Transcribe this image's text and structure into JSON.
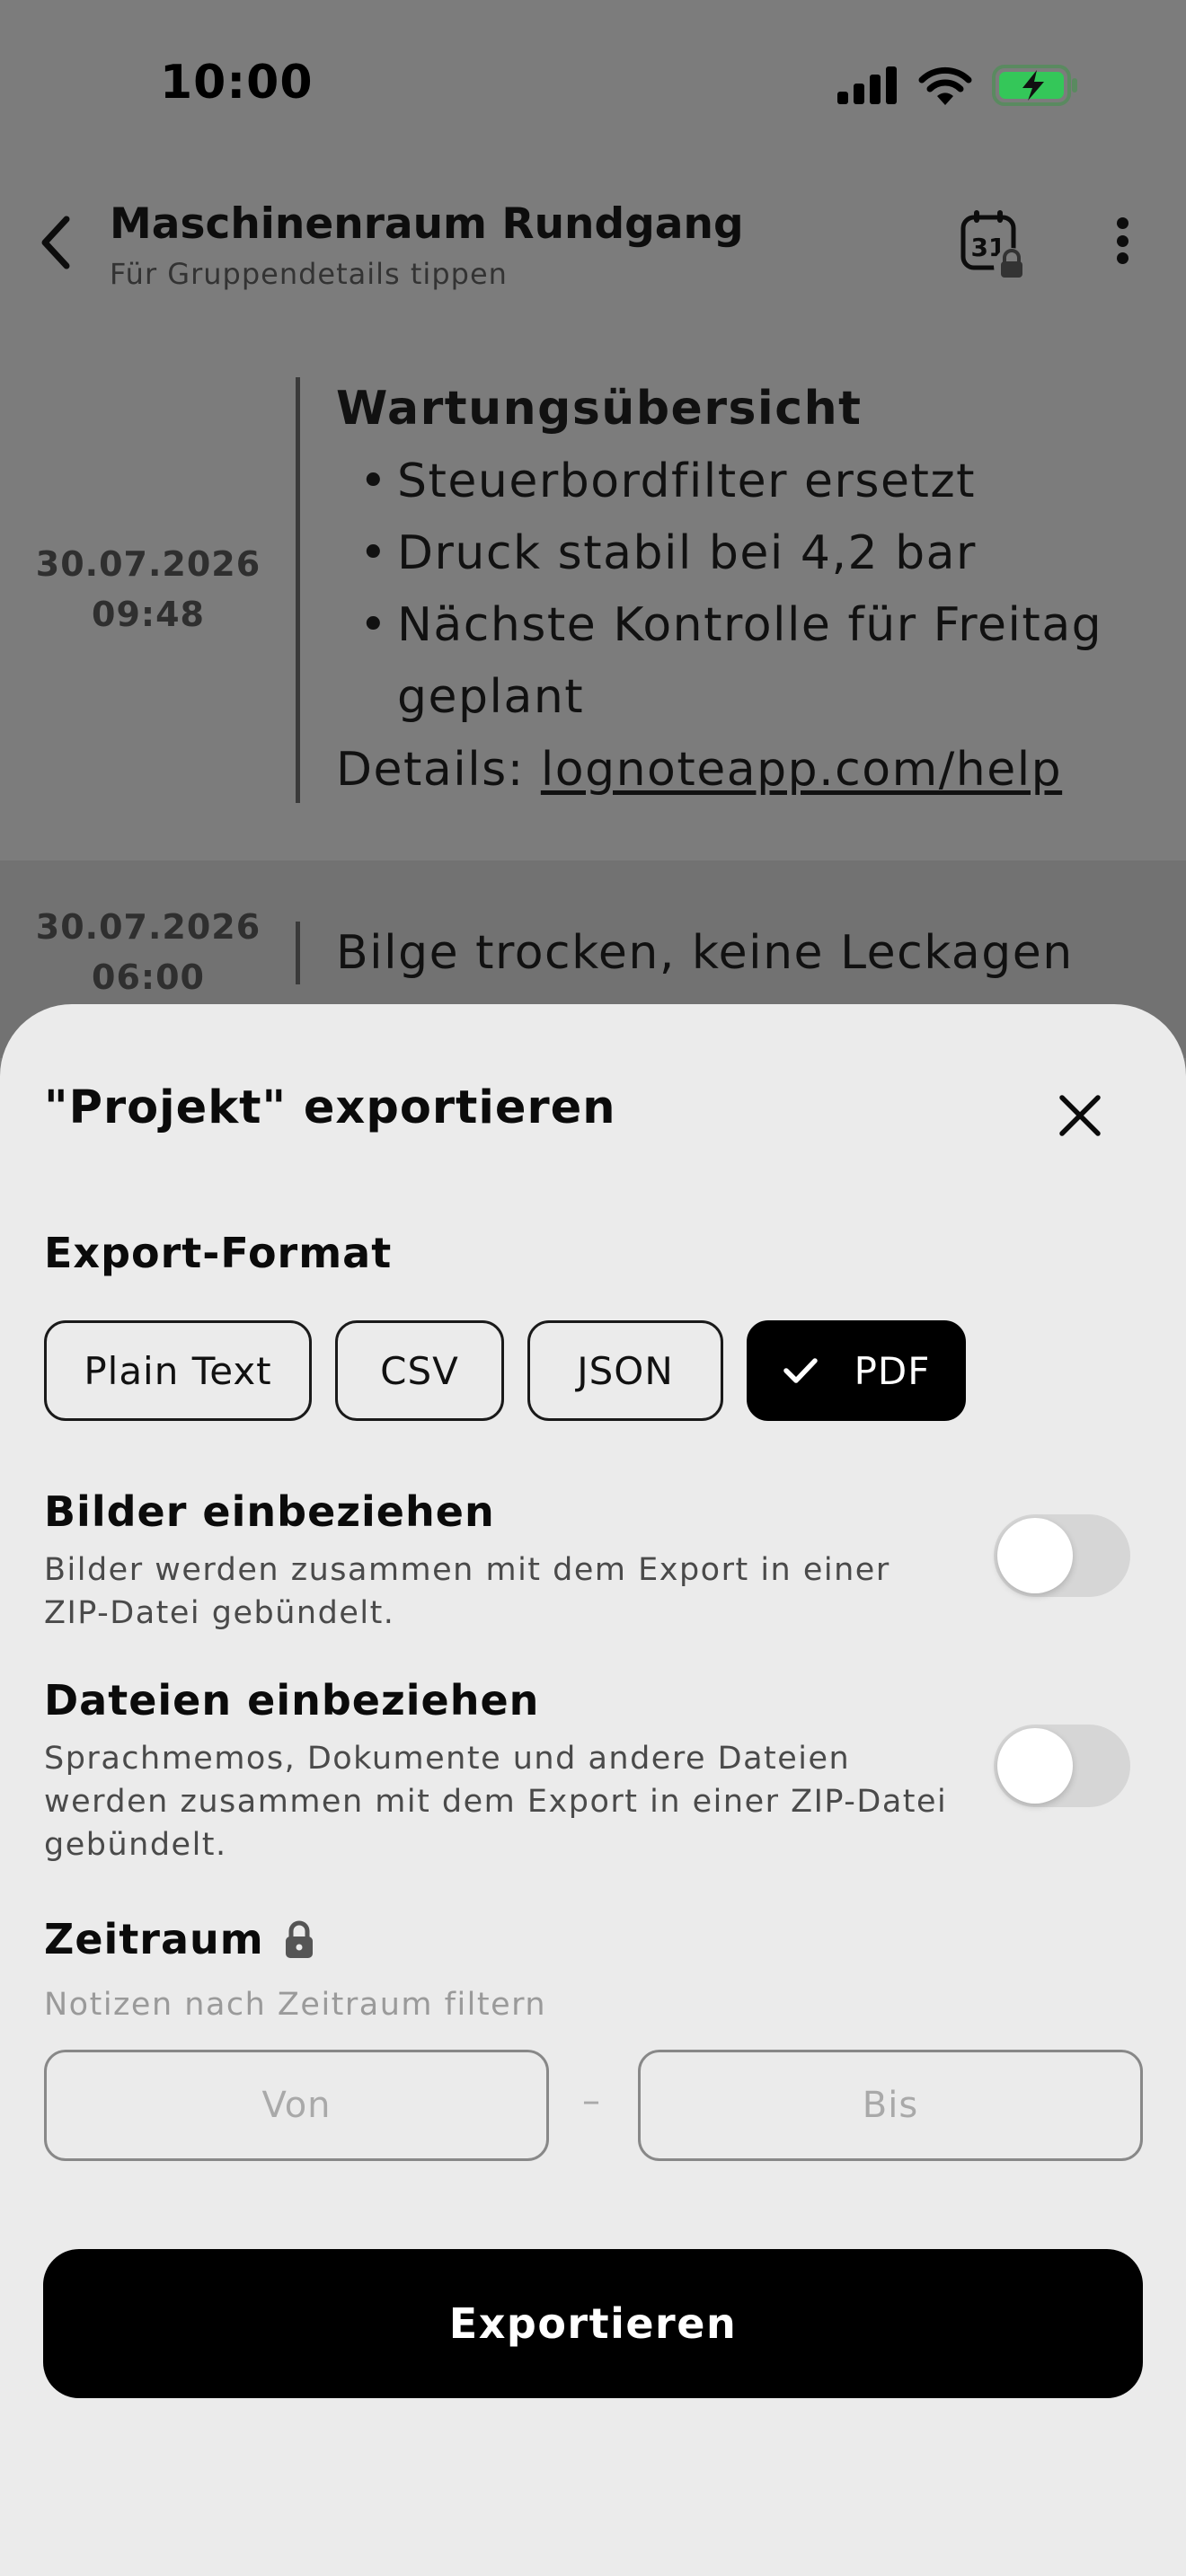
{
  "status_bar": {
    "time": "10:00",
    "icons": [
      "cellular-signal-icon",
      "wifi-icon",
      "battery-charging-icon"
    ],
    "battery_color": "#34c759"
  },
  "header": {
    "title": "Maschinenraum Rundgang",
    "subtitle": "Für Gruppendetails tippen",
    "calendar_icon_text": "31",
    "icons": [
      "back-chevron-icon",
      "calendar-lock-icon",
      "more-vertical-icon"
    ]
  },
  "notes": [
    {
      "date": "30.07.2026",
      "time": "09:48",
      "heading": "Wartungsübersicht",
      "bullets": [
        "Steuerbordfilter ersetzt",
        "Druck stabil bei 4,2 bar",
        "Nächste Kontrolle für Freitag geplant"
      ],
      "details_label": "Details: ",
      "details_link": "lognoteapp.com/help"
    },
    {
      "date": "30.07.2026",
      "time": "06:00",
      "text": "Bilge trocken, keine Leckagen"
    }
  ],
  "export_sheet": {
    "title": "\"Projekt\" exportieren",
    "format_section": "Export-Format",
    "formats": [
      {
        "label": "Plain Text",
        "selected": false
      },
      {
        "label": "CSV",
        "selected": false
      },
      {
        "label": "JSON",
        "selected": false
      },
      {
        "label": "PDF",
        "selected": true
      }
    ],
    "include_images": {
      "title": "Bilder einbeziehen",
      "description": "Bilder werden zusammen mit dem Export in einer ZIP-Datei gebündelt.",
      "enabled": false
    },
    "include_files": {
      "title": "Dateien einbeziehen",
      "description": "Sprachmemos, Dokumente und andere Dateien werden zusammen mit dem Export in einer ZIP-Datei gebündelt.",
      "enabled": false
    },
    "date_range": {
      "title": "Zeitraum",
      "hint": "Notizen nach Zeitraum filtern",
      "from_placeholder": "Von",
      "separator": "–",
      "to_placeholder": "Bis",
      "locked": true
    },
    "export_button": "Exportieren"
  }
}
